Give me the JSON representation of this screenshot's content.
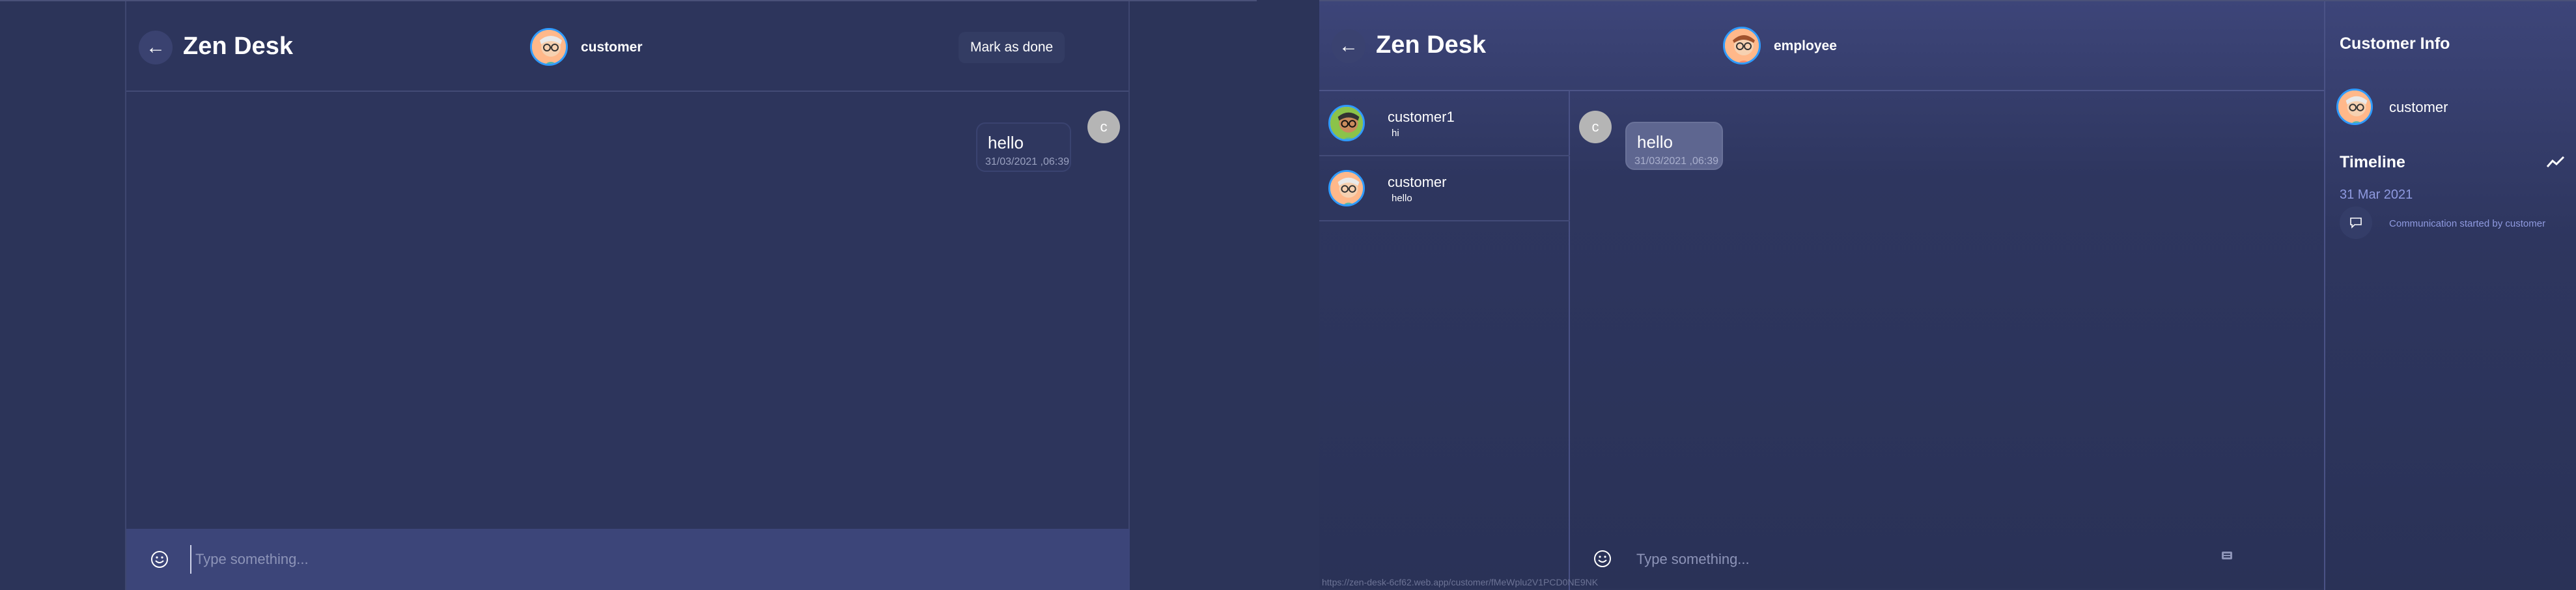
{
  "left_window": {
    "header": {
      "back_icon": "arrow-left-icon",
      "title": "Zen Desk",
      "user_name": "customer",
      "mark_done_label": "Mark as done"
    },
    "messages": [
      {
        "text": "hello",
        "timestamp": "31/03/2021 ,06:39",
        "sender_initial": "c"
      }
    ],
    "composer": {
      "emoji_icon": "smiley-icon",
      "placeholder": "Type something..."
    }
  },
  "right_window": {
    "header": {
      "back_icon": "arrow-left-icon",
      "title": "Zen Desk",
      "user_name": "employee"
    },
    "conversations": [
      {
        "name": "customer1",
        "preview": "hi"
      },
      {
        "name": "customer",
        "preview": "hello"
      }
    ],
    "messages": [
      {
        "text": "hello",
        "timestamp": "31/03/2021 ,06:39",
        "sender_initial": "c"
      }
    ],
    "composer": {
      "emoji_icon": "smiley-icon",
      "placeholder": "Type something...",
      "attach_icon": "keyboard-icon"
    },
    "info_panel": {
      "heading": "Customer Info",
      "customer_name": "customer",
      "timeline_heading": "Timeline",
      "timeline_icon": "trend-icon",
      "timeline_date": "31 Mar 2021",
      "timeline_event": "Communication started by customer",
      "event_icon": "chat-bubble-icon"
    },
    "status_url": "https://zen-desk-6cf62.web.app/customer/fMeWplu2V1PCD0NE9NK"
  },
  "colors": {
    "background": "#2c3459",
    "composer": "#3c4579",
    "avatar_ring": "#2f9bff",
    "timeline_text": "#8f9ae0"
  }
}
